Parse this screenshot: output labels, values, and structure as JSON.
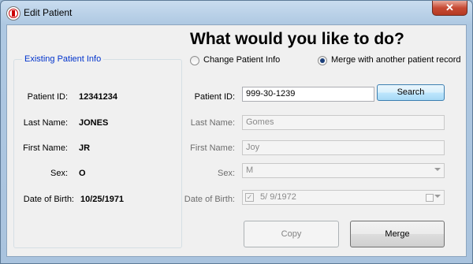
{
  "window": {
    "title": "Edit Patient",
    "close_glyph": "✕"
  },
  "existing": {
    "legend": "Existing Patient Info",
    "patient_id_label": "Patient ID:",
    "patient_id": "12341234",
    "last_name_label": "Last Name:",
    "last_name": "JONES",
    "first_name_label": "First Name:",
    "first_name": "JR",
    "sex_label": "Sex:",
    "sex": "O",
    "dob_label": "Date of Birth:",
    "dob": "10/25/1971"
  },
  "action": {
    "heading": "What would you like to do?",
    "option_change": "Change Patient Info",
    "option_merge": "Merge with another patient record",
    "selected": "merge"
  },
  "form": {
    "patient_id_label": "Patient ID:",
    "patient_id": "999-30-1239",
    "search_button": "Search",
    "last_name_label": "Last Name:",
    "last_name": "Gomes",
    "first_name_label": "First Name:",
    "first_name": "Joy",
    "sex_label": "Sex:",
    "sex": "M",
    "dob_label": "Date of Birth:",
    "dob": "5/ 9/1972",
    "dob_checked": true
  },
  "buttons": {
    "copy": "Copy",
    "merge": "Merge"
  }
}
